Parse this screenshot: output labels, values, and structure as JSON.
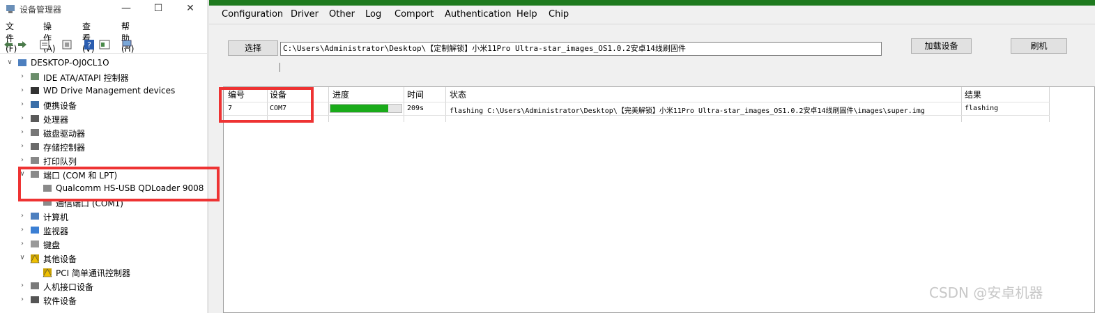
{
  "device_manager": {
    "title": "设备管理器",
    "window_controls": {
      "minimize": "—",
      "maximize": "☐",
      "close": "✕"
    },
    "menu": [
      "文件(F)",
      "操作(A)",
      "查看(V)",
      "帮助(H)"
    ],
    "tree": [
      {
        "label": "DESKTOP-OJ0CL1O",
        "icon": "computer-icon",
        "expander": "∨"
      },
      {
        "label": "IDE ATA/ATAPI 控制器",
        "icon": "ide-controller-icon",
        "expander": "›"
      },
      {
        "label": "WD Drive Management devices",
        "icon": "wd-device-icon",
        "expander": "›"
      },
      {
        "label": "便携设备",
        "icon": "portable-device-icon",
        "expander": "›"
      },
      {
        "label": "处理器",
        "icon": "processor-icon",
        "expander": "›"
      },
      {
        "label": "磁盘驱动器",
        "icon": "disk-drive-icon",
        "expander": "›"
      },
      {
        "label": "存储控制器",
        "icon": "storage-controller-icon",
        "expander": "›"
      },
      {
        "label": "打印队列",
        "icon": "printer-icon",
        "expander": "›"
      },
      {
        "label": "端口 (COM 和 LPT)",
        "icon": "port-icon",
        "expander": "∨"
      },
      {
        "label": "Qualcomm HS-USB QDLoader 9008",
        "icon": "port-icon",
        "expander": ""
      },
      {
        "label": "通信端口 (COM1)",
        "icon": "port-icon",
        "expander": ""
      },
      {
        "label": "计算机",
        "icon": "computer-icon",
        "expander": "›"
      },
      {
        "label": "监视器",
        "icon": "monitor-icon",
        "expander": "›"
      },
      {
        "label": "键盘",
        "icon": "keyboard-icon",
        "expander": "›"
      },
      {
        "label": "其他设备",
        "icon": "warning-device-icon",
        "expander": "∨"
      },
      {
        "label": "PCI 简单通讯控制器",
        "icon": "warning-device-icon",
        "expander": ""
      },
      {
        "label": "人机接口设备",
        "icon": "hid-icon",
        "expander": "›"
      },
      {
        "label": "软件设备",
        "icon": "software-device-icon",
        "expander": "›"
      }
    ]
  },
  "flash_tool": {
    "menu": [
      "Configuration",
      "Driver",
      "Other",
      "Log",
      "Comport",
      "Authentication",
      "Help",
      "Chip"
    ],
    "select_button": "选择",
    "path_value": "C:\\Users\\Administrator\\Desktop\\【定制解锁】小米11Pro Ultra-star_images_OS1.0.2安卓14线刷固件",
    "load_device_button": "加载设备",
    "flash_button": "刷机",
    "columns": [
      "编号",
      "设备",
      "进度",
      "时间",
      "状态",
      "结果"
    ],
    "rows": [
      {
        "id": "7",
        "device": "COM7",
        "progress": 0.81,
        "time": "209s",
        "status": "flashing C:\\Users\\Administrator\\Desktop\\【完美解锁】小米11Pro Ultra-star_images_OS1.0.2安卓14线刷固件\\images\\super.img",
        "result": "flashing"
      }
    ],
    "progress_color": "#1aab1a"
  },
  "watermark": "CSDN @安卓机器",
  "colors": {
    "highlight_red": "#ee3333",
    "title_green": "#1e7a1e"
  }
}
